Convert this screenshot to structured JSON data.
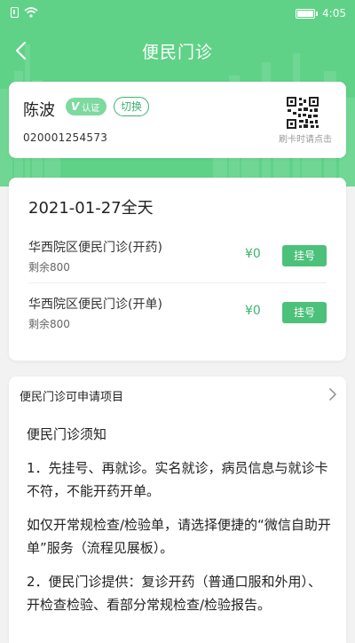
{
  "status_bar": {
    "time": "4:05"
  },
  "nav": {
    "title": "便民门诊"
  },
  "user": {
    "name": "陈波",
    "verified_label": "认证",
    "verified_mark": "V",
    "switch_label": "切换",
    "card_number": "020001254573",
    "qr_hint": "刷卡时请点击"
  },
  "schedule": {
    "date": "2021-01-27全天",
    "slots": [
      {
        "name": "华西院区便民门诊(开药)",
        "remaining": "剩余800",
        "price": "¥0",
        "button": "挂号"
      },
      {
        "name": "华西院区便民门诊(开单)",
        "remaining": "剩余800",
        "price": "¥0",
        "button": "挂号"
      }
    ]
  },
  "info": {
    "header": "便民门诊可申请项目",
    "paragraphs": [
      "便民门诊须知",
      "1．先挂号、再就诊。实名就诊，病员信息与就诊卡不符，不能开药开单。",
      "如仅开常规检查/检验单，请选择便捷的“微信自助开单”服务（流程见展板）。",
      "2．便民门诊提供：复诊开药（普通口服和外用）、开检查检验、看部分常规检查/检验报告。"
    ]
  },
  "colors": {
    "header_green": "#5fd287",
    "accent_green": "#3cb371",
    "button_green": "#4cc17a"
  }
}
